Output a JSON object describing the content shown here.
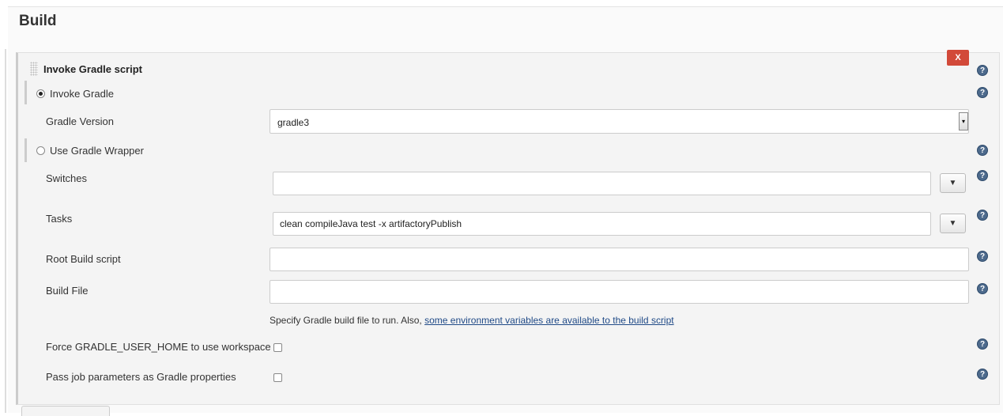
{
  "section": {
    "title": "Build"
  },
  "step": {
    "title": "Invoke Gradle script",
    "delete_label": "X",
    "help_glyph": "?"
  },
  "invoke_gradle": {
    "label": "Invoke Gradle",
    "selected": true
  },
  "gradle_version": {
    "label": "Gradle Version",
    "value": "gradle3"
  },
  "use_wrapper": {
    "label": "Use Gradle Wrapper",
    "selected": false
  },
  "switches": {
    "label": "Switches",
    "value": "",
    "expand_glyph": "▼"
  },
  "tasks": {
    "label": "Tasks",
    "value": "clean compileJava  test -x artifactoryPublish",
    "expand_glyph": "▼"
  },
  "root_build_script": {
    "label": "Root Build script",
    "value": ""
  },
  "build_file": {
    "label": "Build File",
    "value": "",
    "hint_text": "Specify Gradle build file to run. Also, ",
    "hint_link": "some environment variables are available to the build script"
  },
  "force_user_home": {
    "label": "Force GRADLE_USER_HOME to use workspace",
    "checked": false
  },
  "pass_params": {
    "label": "Pass job parameters as Gradle properties",
    "checked": false
  },
  "colors": {
    "delete_button": "#d24939",
    "help_icon": "#4d6a8c",
    "link": "#204a87"
  }
}
